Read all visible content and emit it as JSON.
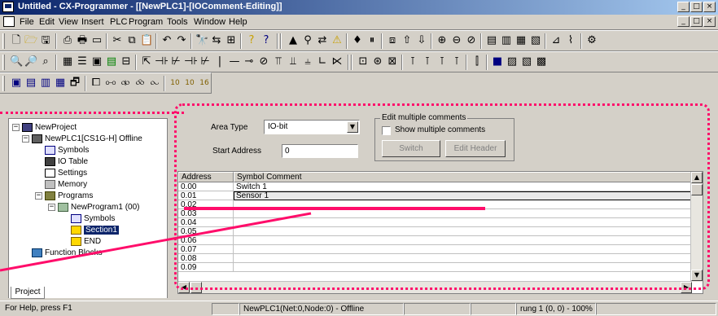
{
  "window": {
    "title": "Untitled - CX-Programmer - [[NewPLC1]-[IOComment-Editing]]",
    "caption_buttons": [
      "_",
      "□",
      "×"
    ]
  },
  "menu": {
    "items": [
      "File",
      "Edit",
      "View",
      "Insert",
      "PLC",
      "Program",
      "Tools",
      "Window",
      "Help"
    ]
  },
  "project_tree": {
    "root": "NewProject",
    "plc": "NewPLC1[CS1G-H] Offline",
    "plc_children": [
      "Symbols",
      "IO Table",
      "Settings",
      "Memory",
      "Programs"
    ],
    "program": "NewProgram1 (00)",
    "program_children": [
      "Symbols",
      "Section1",
      "END"
    ],
    "function_blocks": "Function Blocks",
    "tab": "Project"
  },
  "editor": {
    "area_type_label": "Area Type",
    "area_type_value": "IO-bit",
    "start_address_label": "Start Address",
    "start_address_value": "0",
    "multi_group_label": "Edit multiple comments",
    "show_multiple_label": "Show multiple comments",
    "switch_button": "Switch",
    "edit_header_button": "Edit Header",
    "columns": [
      "Address",
      "Symbol Comment"
    ],
    "rows": [
      {
        "address": "0.00",
        "comment": "Switch 1"
      },
      {
        "address": "0.01",
        "comment": "Sensor 1"
      },
      {
        "address": "0.02",
        "comment": ""
      },
      {
        "address": "0.03",
        "comment": ""
      },
      {
        "address": "0.04",
        "comment": ""
      },
      {
        "address": "0.05",
        "comment": ""
      },
      {
        "address": "0.06",
        "comment": ""
      },
      {
        "address": "0.07",
        "comment": ""
      },
      {
        "address": "0.08",
        "comment": ""
      },
      {
        "address": "0.09",
        "comment": ""
      }
    ],
    "selected_row": 1
  },
  "statusbar": {
    "help": "For Help, press F1",
    "connection": "NewPLC1(Net:0,Node:0) - Offline",
    "position": "rung 1 (0, 0) - 100%"
  },
  "colors": {
    "annotation": "#ff0d6a",
    "title_gradient_start": "#0a246a",
    "title_gradient_end": "#a6caf0",
    "face": "#d4d0c8"
  }
}
